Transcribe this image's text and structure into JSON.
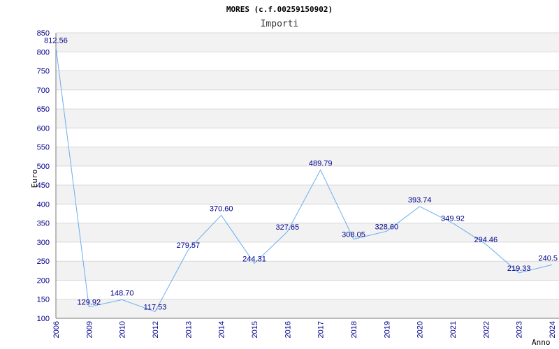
{
  "chart_data": {
    "type": "line",
    "title": "MORES (c.f.00259150902)",
    "subtitle": "Importi",
    "xlabel": "Anno",
    "ylabel": "Euro",
    "categories": [
      "2006",
      "2009",
      "2010",
      "2012",
      "2013",
      "2014",
      "2015",
      "2016",
      "2017",
      "2018",
      "2019",
      "2020",
      "2021",
      "2022",
      "2023",
      "2024"
    ],
    "series": [
      {
        "values": [
          812.56,
          129.92,
          148.7,
          117.53,
          279.57,
          370.6,
          244.31,
          327.65,
          489.79,
          308.05,
          328.6,
          393.74,
          349.92,
          294.46,
          219.33,
          240.5
        ],
        "labels": [
          "812.56",
          "129.92",
          "148.70",
          "117.53",
          "279.57",
          "370.60",
          "244.31",
          "327.65",
          "489.79",
          "308.05",
          "328.60",
          "393.74",
          "349.92",
          "294.46",
          "219.33",
          "240.5"
        ]
      }
    ],
    "ylim": [
      100,
      850
    ],
    "ytick_step": 50,
    "grid": true,
    "colors": {
      "line": "#6aaef0",
      "band": "#f2f2f2",
      "grid": "#d8d8d8",
      "tick_text": "#00008b",
      "axis": "#7a7a7a"
    }
  }
}
